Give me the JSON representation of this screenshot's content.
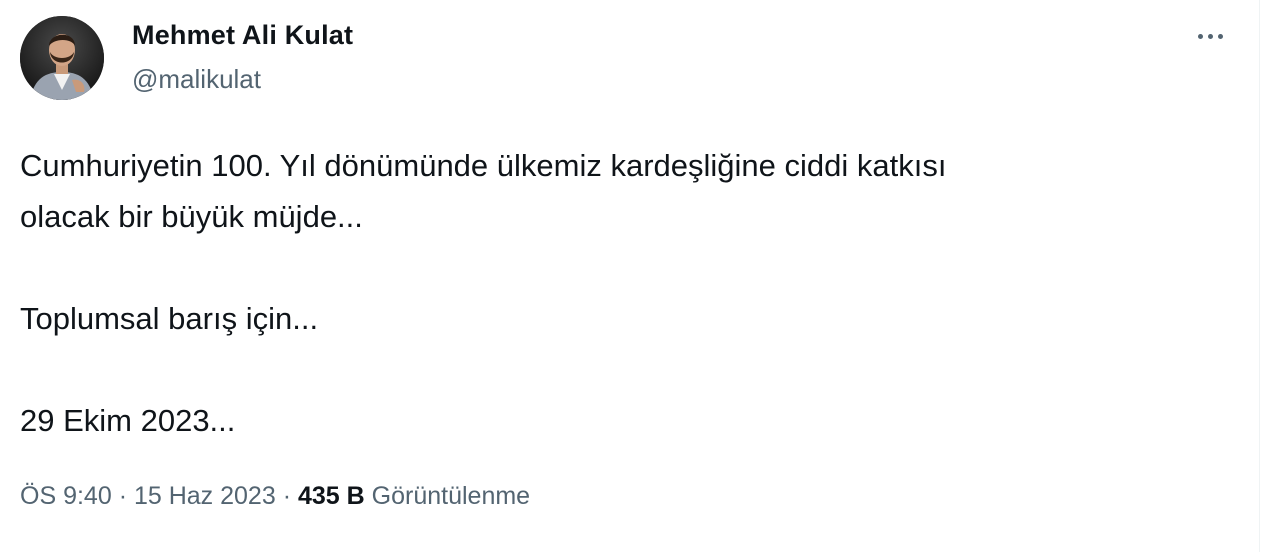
{
  "author": {
    "name": "Mehmet Ali Kulat",
    "handle": "@malikulat"
  },
  "more_icon": "more-horizontal-icon",
  "tweet": {
    "lines": [
      "Cumhuriyetin 100. Yıl dönümünde ülkemiz kardeşliğine ciddi katkısı",
      "olacak bir büyük müjde...",
      "Toplumsal barış için...",
      "29 Ekim 2023..."
    ]
  },
  "meta": {
    "time": "ÖS 9:40",
    "separator": "·",
    "date": "15 Haz 2023",
    "views_count": "435 B",
    "views_label": "Görüntülenme"
  },
  "colors": {
    "text": "#0f1419",
    "secondary": "#536471"
  }
}
